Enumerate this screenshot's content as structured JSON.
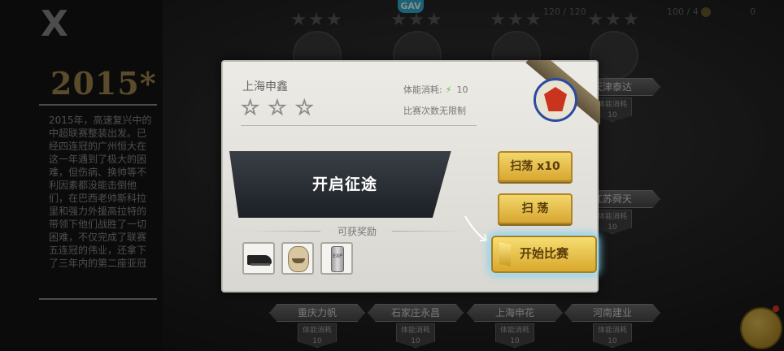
{
  "app": {
    "close_glyph": "X",
    "top_logo": "GAV",
    "stamina_text": "120 / 120",
    "coins_text": "100 / 4",
    "gems_text": "0"
  },
  "story": {
    "year": "2015*",
    "text": "2015年，高速复兴中的中超联赛整装出发。已经四连冠的广州恒大在这一年遇到了极大的困难，但伤病、换帅等不利因素都没能击倒他们，在巴西老帅斯科拉里和强力外援高拉特的带领下他们战胜了一切困难，不仅完成了联赛五连冠的伟业，还拿下了三年内的第二座亚冠"
  },
  "background_teams": {
    "right_plates": [
      {
        "name": "天津泰达",
        "cost_label": "体能消耗",
        "cost": "10"
      },
      {
        "name": "江苏舜天",
        "cost_label": "体能消耗",
        "cost": "10"
      }
    ],
    "bottom_plates": [
      {
        "name": "重庆力帆",
        "cost_label": "体能消耗",
        "cost": "10"
      },
      {
        "name": "石家庄永昌",
        "cost_label": "体能消耗",
        "cost": "10"
      },
      {
        "name": "上海申花",
        "cost_label": "体能消耗",
        "cost": "10"
      },
      {
        "name": "河南建业",
        "cost_label": "体能消耗",
        "cost": "10"
      }
    ]
  },
  "modal": {
    "team_name": "上海申鑫",
    "stars": "☆☆☆",
    "stamina_label": "体能消耗:",
    "stamina_value": "10",
    "limit_text": "比赛次数无限制",
    "start_journey": "开启征途",
    "rewards_label": "可获奖励",
    "rewards": [
      {
        "icon": "boot-icon"
      },
      {
        "icon": "coach-face-icon"
      },
      {
        "icon": "exp-can-icon",
        "text": "EXP"
      }
    ],
    "sweep_x10": "扫荡 x10",
    "sweep": "扫 荡",
    "start_match": "开始比赛"
  },
  "colors": {
    "accent_gold": "#d7a630",
    "highlight_glow": "#7fd0f3",
    "stamina_bolt": "#5dbb3c"
  }
}
